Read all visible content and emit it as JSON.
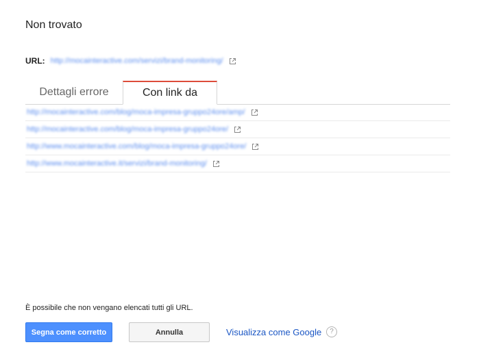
{
  "header": {
    "title": "Non trovato"
  },
  "url": {
    "label": "URL:",
    "value": "http://mocainteractive.com/servizi/brand-monitoring/",
    "external_icon": "external-link-icon"
  },
  "tabs": [
    {
      "label": "Dettagli errore",
      "active": false
    },
    {
      "label": "Con link da",
      "active": true
    }
  ],
  "linked_from": [
    {
      "url": "http://mocainteractive.com/blog/moca-impresa-gruppo24ore/amp/"
    },
    {
      "url": "http://mocainteractive.com/blog/moca-impresa-gruppo24ore/"
    },
    {
      "url": "http://www.mocainteractive.com/blog/moca-impresa-gruppo24ore/"
    },
    {
      "url": "http://www.mocainteractive.it/servizi/brand-monitoring/"
    }
  ],
  "footer": {
    "note": "È possibile che non vengano elencati tutti gli URL.",
    "primary_button": "Segna come corretto",
    "secondary_button": "Annulla",
    "fetch_link": "Visualizza come Google",
    "help_icon": "help-icon"
  },
  "colors": {
    "accent": "#4d90fe",
    "active_tab_border": "#dd4b39",
    "link": "#1a56c4"
  }
}
